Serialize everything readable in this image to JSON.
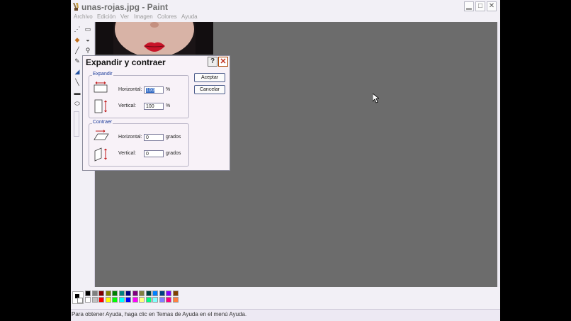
{
  "window": {
    "title": "unas-rojas.jpg - Paint",
    "minimize_icon": "minimize-icon",
    "maximize_icon": "maximize-icon",
    "close_icon": "close-icon"
  },
  "menu": [
    "Archivo",
    "Edición",
    "Ver",
    "Imagen",
    "Colores",
    "Ayuda"
  ],
  "dialog": {
    "title": "Expandir y contraer",
    "expand_group": "Expandir",
    "contract_group": "Contraer",
    "expand_horizontal_label": "Horizontal:",
    "expand_horizontal_value": "100",
    "expand_horizontal_unit": "%",
    "expand_vertical_label": "Vertical:",
    "expand_vertical_value": "100",
    "expand_vertical_unit": "%",
    "contract_horizontal_label": "Horizontal:",
    "contract_horizontal_value": "0",
    "contract_horizontal_unit": "grados",
    "contract_vertical_label": "Vertical:",
    "contract_vertical_value": "0",
    "contract_vertical_unit": "grados",
    "ok_label": "Aceptar",
    "cancel_label": "Cancelar"
  },
  "status": {
    "text": "Para obtener Ayuda, haga clic en Temas de Ayuda en el menú Ayuda."
  },
  "palette": {
    "foreground": "#000000",
    "background": "#ffffff",
    "row1": [
      "#000000",
      "#808080",
      "#800000",
      "#808000",
      "#008000",
      "#008080",
      "#000080",
      "#800080",
      "#808040",
      "#004040",
      "#0080ff",
      "#004080",
      "#8000ff",
      "#804000"
    ],
    "row2": [
      "#ffffff",
      "#c0c0c0",
      "#ff0000",
      "#ffff00",
      "#00ff00",
      "#00ffff",
      "#0000ff",
      "#ff00ff",
      "#ffff80",
      "#00ff80",
      "#80ffff",
      "#8080ff",
      "#ff0080",
      "#ff8040"
    ]
  }
}
